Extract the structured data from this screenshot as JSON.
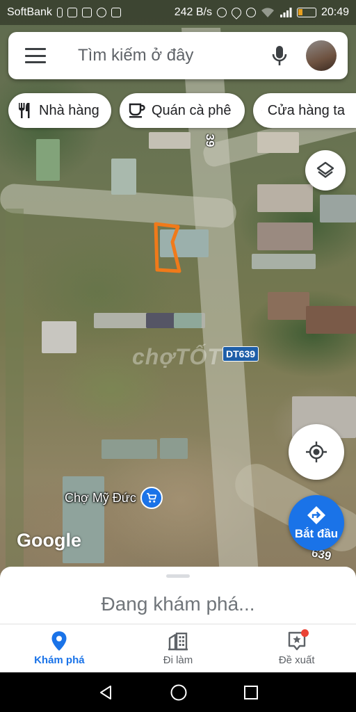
{
  "status_bar": {
    "carrier": "SoftBank",
    "speed": "242 B/s",
    "time": "20:49",
    "battery_color": "#e8a020"
  },
  "search": {
    "placeholder": "Tìm kiếm ở đây",
    "menu_icon": "hamburger-icon",
    "mic_icon": "mic-icon",
    "avatar_icon": "avatar"
  },
  "chips": [
    {
      "label": "Nhà hàng",
      "icon": "fork-knife-icon"
    },
    {
      "label": "Quán cà phê",
      "icon": "coffee-cup-icon"
    },
    {
      "label": "Cửa hàng ta",
      "icon": "shopping-cart-icon"
    }
  ],
  "map": {
    "watermark": "chợTỐT",
    "road_shield": "DT639",
    "road_number_top": "39",
    "road_number_bottom": "639",
    "market_label": "Chợ Mỹ Đức",
    "google_logo": "Google",
    "highlight_color": "#f07a1a"
  },
  "controls": {
    "layers_icon": "layers-icon",
    "location_icon": "my-location-icon",
    "start_label": "Bắt đầu",
    "start_icon": "directions-icon",
    "accent_color": "#1a73e8"
  },
  "sheet": {
    "explore_text": "Đang khám phá..."
  },
  "nav": [
    {
      "label": "Khám phá",
      "icon": "pin-icon",
      "active": true
    },
    {
      "label": "Đi làm",
      "icon": "commute-icon",
      "active": false
    },
    {
      "label": "Đề xuất",
      "icon": "contribute-icon",
      "active": false,
      "badge": true
    }
  ],
  "system_nav": [
    "back-icon",
    "home-icon",
    "recents-icon"
  ]
}
